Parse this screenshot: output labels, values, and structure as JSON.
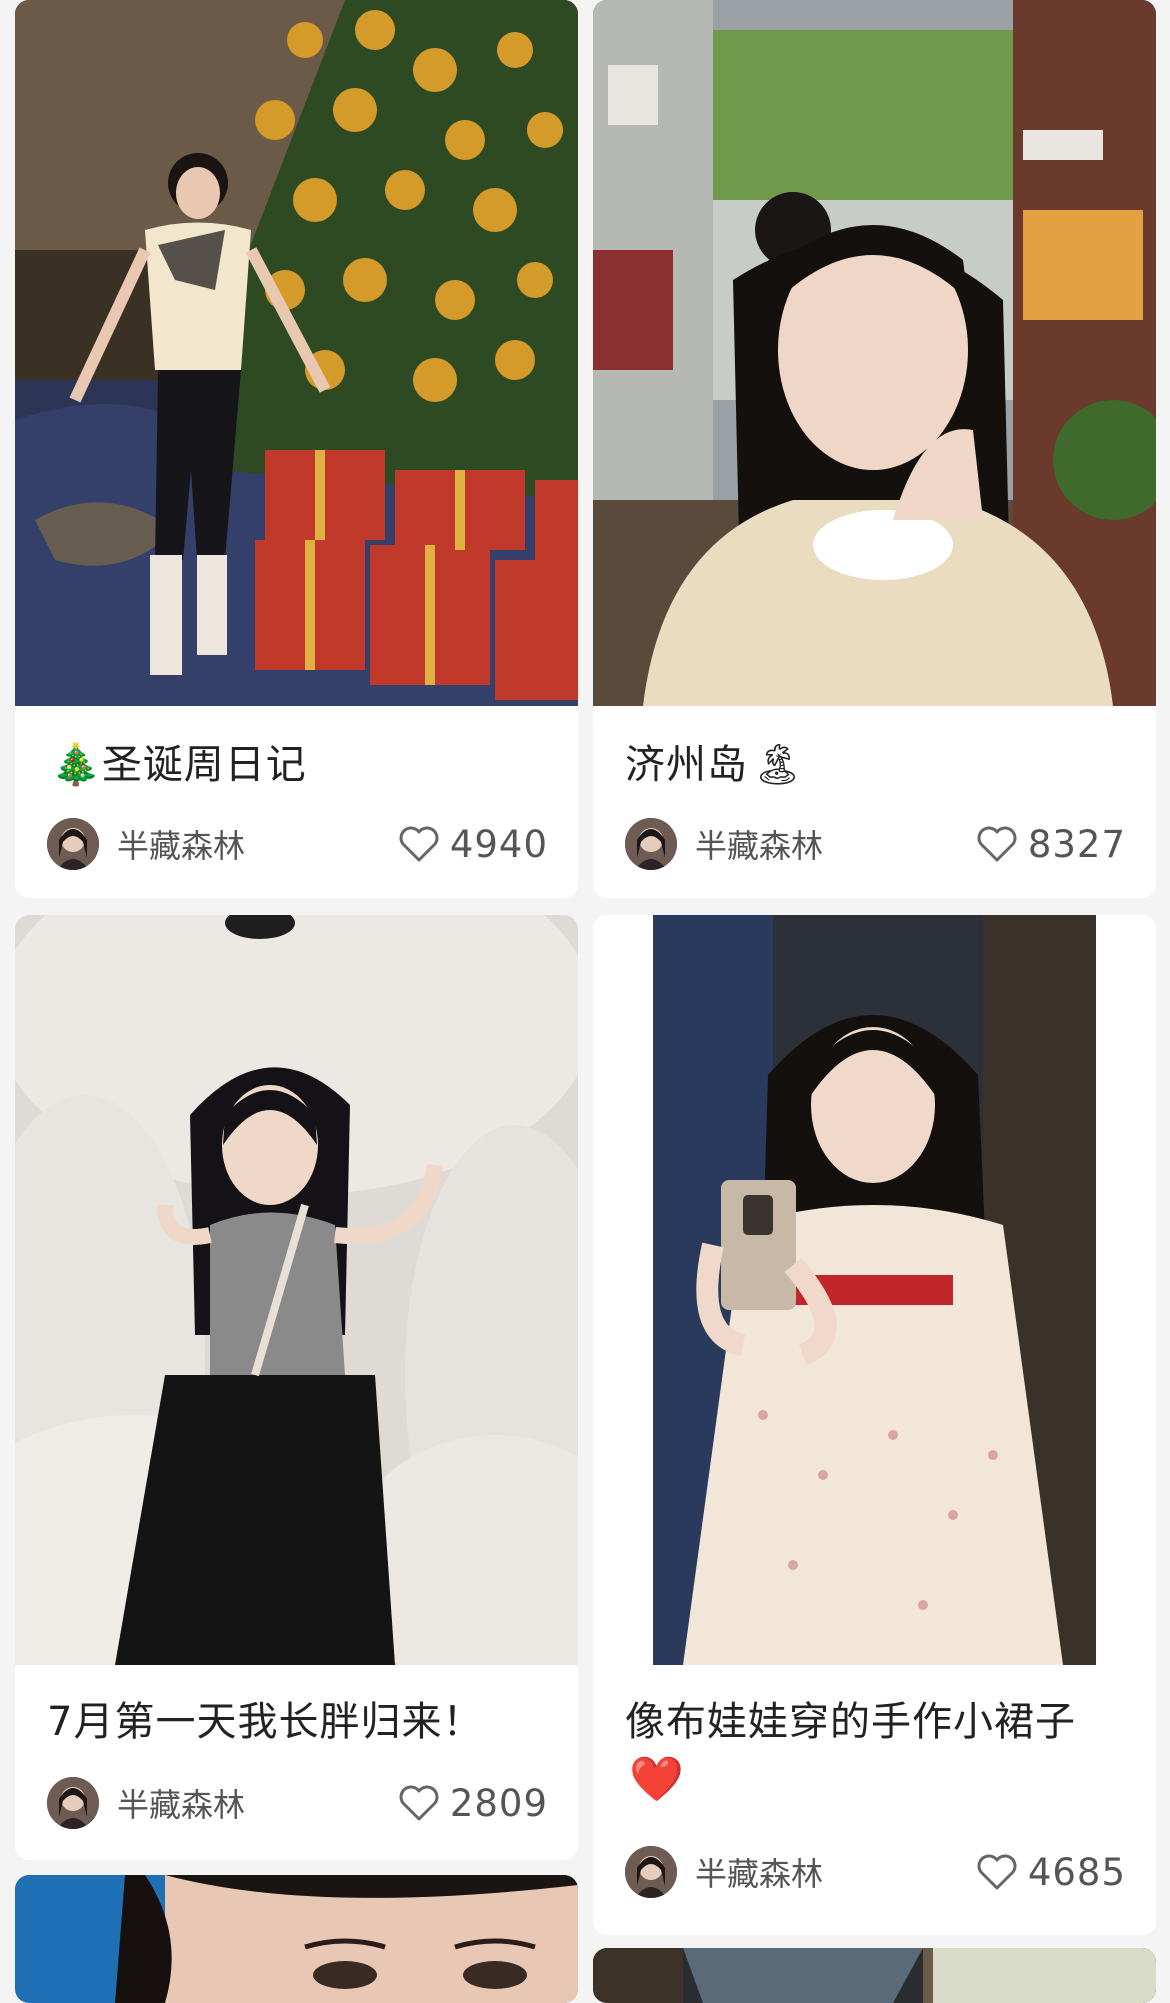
{
  "cards": [
    {
      "title": "圣诞周日记",
      "title_emoji": "🎄",
      "title_emoji_first": true,
      "author": "半藏森林",
      "likes": "4940"
    },
    {
      "title": "济州岛",
      "title_emoji": "🏝",
      "title_emoji_first": false,
      "author": "半藏森林",
      "likes": "8327"
    },
    {
      "title": "7月第一天我长胖归来！",
      "title_emoji": "",
      "author": "半藏森林",
      "likes": "2809"
    },
    {
      "title": "像布娃娃穿的手作小裙子",
      "title_emoji": "❤️",
      "author": "半藏森林",
      "likes": "4685"
    }
  ],
  "icons": {
    "like": "heart-outline-icon",
    "avatar": "author-avatar"
  },
  "colors": {
    "background": "#f4f4f4",
    "card": "#ffffff",
    "text": "#222222",
    "meta_text": "#555555",
    "heart": "#e0202a"
  }
}
